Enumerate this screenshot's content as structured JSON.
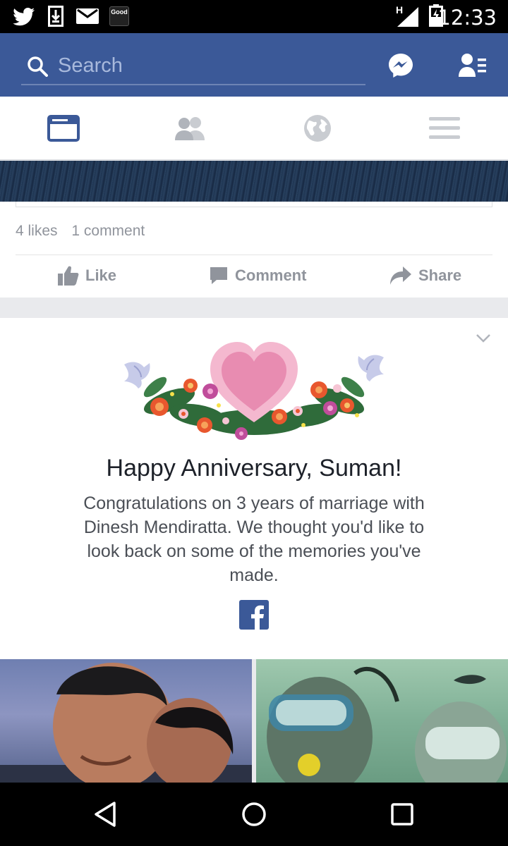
{
  "status_bar": {
    "time": "12:33",
    "good_badge": "Good",
    "network_label": "H",
    "icons": [
      "twitter-icon",
      "download-icon",
      "gmail-icon",
      "good-app-icon",
      "signal-icon",
      "battery-charging-icon"
    ]
  },
  "app_bar": {
    "search_placeholder": "Search",
    "icons": [
      "search-icon",
      "messenger-icon",
      "friend-requests-icon"
    ]
  },
  "tabs": [
    {
      "name": "news-feed",
      "icon": "news-feed-icon",
      "active": true
    },
    {
      "name": "friends",
      "icon": "friends-icon",
      "active": false
    },
    {
      "name": "notifications",
      "icon": "globe-icon",
      "active": false
    },
    {
      "name": "more",
      "icon": "menu-icon",
      "active": false
    }
  ],
  "post": {
    "likes": "4 likes",
    "comments": "1 comment",
    "actions": {
      "like": "Like",
      "comment": "Comment",
      "share": "Share"
    }
  },
  "anniversary": {
    "title": "Happy Anniversary, Suman!",
    "message": "Congratulations on 3 years of marriage with Dinesh Mendiratta. We thought you'd like to look back on some of the memories you've made."
  },
  "colors": {
    "brand": "#3b5998",
    "muted_text": "#90949c",
    "title_text": "#1d2129"
  }
}
